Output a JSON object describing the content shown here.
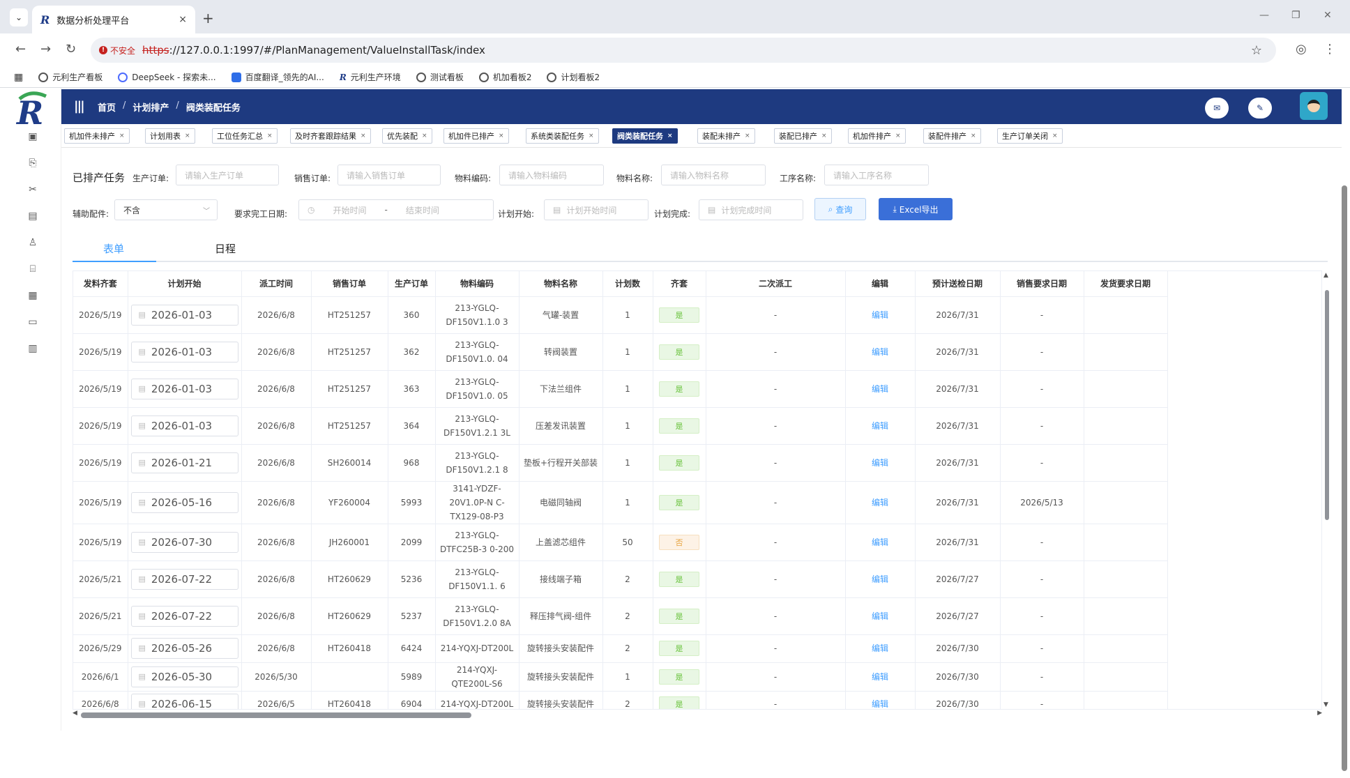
{
  "browser": {
    "tab_title": "数据分析处理平台",
    "tab_close": "×",
    "new_tab": "+",
    "insecure_label": "不安全",
    "url_proto": "https",
    "url_rest": "://127.0.0.1:1997/#/PlanManagement/ValueInstallTask/index",
    "bookmarks": [
      "元利生产看板",
      "DeepSeek - 探索未...",
      "百度翻译_领先的AI...",
      "元利生产环境",
      "测试看板",
      "机加看板2",
      "计划看板2"
    ]
  },
  "header": {
    "breadcrumb": [
      "首页",
      "计划排产",
      "阀类装配任务"
    ],
    "sep": "/"
  },
  "tags": [
    {
      "label": "机加件未排产",
      "active": false
    },
    {
      "label": "计划用表",
      "active": false
    },
    {
      "label": "工位任务汇总",
      "active": false
    },
    {
      "label": "及时齐套跟踪结果",
      "active": false
    },
    {
      "label": "优先装配",
      "active": false
    },
    {
      "label": "机加件已排产",
      "active": false
    },
    {
      "label": "系统类装配任务",
      "active": false
    },
    {
      "label": "阀类装配任务",
      "active": true
    },
    {
      "label": "装配未排产",
      "active": false
    },
    {
      "label": "装配已排产",
      "active": false
    },
    {
      "label": "机加件排产",
      "active": false
    },
    {
      "label": "装配件排产",
      "active": false
    },
    {
      "label": "生产订单关闭",
      "active": false
    }
  ],
  "filters": {
    "title": "已排产任务",
    "prod_order_label": "生产订单:",
    "prod_order_placeholder": "请输入生产订单",
    "sales_order_label": "销售订单:",
    "sales_order_placeholder": "请输入销售订单",
    "material_code_label": "物料编码:",
    "material_code_placeholder": "请输入物料编码",
    "material_name_label": "物料名称:",
    "material_name_placeholder": "请输入物料名称",
    "process_label": "工序名称:",
    "process_placeholder": "请输入工序名称",
    "aux_label": "辅助配件:",
    "aux_value": "不含",
    "due_label": "要求完工日期:",
    "start_placeholder": "开始时间",
    "range_sep": "-",
    "end_placeholder": "结束时间",
    "plan_start_label": "计划开始:",
    "plan_start_placeholder": "计划开始时间",
    "plan_end_label": "计划完成:",
    "plan_end_placeholder": "计划完成时间",
    "query_btn": "查询",
    "excel_btn": "Excel导出"
  },
  "view_tabs": [
    "表单",
    "日程"
  ],
  "table": {
    "columns": [
      "发料齐套",
      "计划开始",
      "派工时间",
      "销售订单",
      "生产订单",
      "物料编码",
      "物料名称",
      "计划数",
      "齐套",
      "二次派工",
      "编辑",
      "预计送检日期",
      "销售要求日期",
      "发货要求日期"
    ],
    "rows": [
      [
        "2026/5/19",
        "2026-01-03",
        "2026/6/8",
        "HT251257",
        "360",
        "213-YGLQ-DF150V1.1.0 3",
        "气罐-装置",
        "1",
        "是",
        "-",
        "编辑",
        "2026/7/31",
        "-",
        ""
      ],
      [
        "2026/5/19",
        "2026-01-03",
        "2026/6/8",
        "HT251257",
        "362",
        "213-YGLQ-DF150V1.0. 04",
        "转阀装置",
        "1",
        "是",
        "-",
        "编辑",
        "2026/7/31",
        "-",
        ""
      ],
      [
        "2026/5/19",
        "2026-01-03",
        "2026/6/8",
        "HT251257",
        "363",
        "213-YGLQ-DF150V1.0. 05",
        "下法兰组件",
        "1",
        "是",
        "-",
        "编辑",
        "2026/7/31",
        "-",
        ""
      ],
      [
        "2026/5/19",
        "2026-01-03",
        "2026/6/8",
        "HT251257",
        "364",
        "213-YGLQ-DF150V1.2.1 3L",
        "压差发讯装置",
        "1",
        "是",
        "-",
        "编辑",
        "2026/7/31",
        "-",
        ""
      ],
      [
        "2026/5/19",
        "2026-01-21",
        "2026/6/8",
        "SH260014",
        "968",
        "213-YGLQ-DF150V1.2.1 8",
        "垫板+行程开关部装",
        "1",
        "是",
        "-",
        "编辑",
        "2026/7/31",
        "-",
        ""
      ],
      [
        "2026/5/19",
        "2026-05-16",
        "2026/6/8",
        "YF260004",
        "5993",
        "3141-YDZF-20V1.0P-N C-TX129-08-P3",
        "电磁同轴阀",
        "1",
        "是",
        "-",
        "编辑",
        "2026/7/31",
        "2026/5/13",
        ""
      ],
      [
        "2026/5/19",
        "2026-07-30",
        "2026/6/8",
        "JH260001",
        "2099",
        "213-YGLQ-DTFC25B-3 0-200",
        "上盖滤芯组件",
        "50",
        "否",
        "-",
        "编辑",
        "2026/7/31",
        "-",
        ""
      ],
      [
        "2026/5/21",
        "2026-07-22",
        "2026/6/8",
        "HT260629",
        "5236",
        "213-YGLQ-DF150V1.1. 6",
        "接线端子箱",
        "2",
        "是",
        "-",
        "编辑",
        "2026/7/27",
        "-",
        ""
      ],
      [
        "2026/5/21",
        "2026-07-22",
        "2026/6/8",
        "HT260629",
        "5237",
        "213-YGLQ-DF150V1.2.0 8A",
        "释压排气阀-组件",
        "2",
        "是",
        "-",
        "编辑",
        "2026/7/27",
        "-",
        ""
      ],
      [
        "2026/5/29",
        "2026-05-26",
        "2026/6/8",
        "HT260418",
        "6424",
        "214-YQXJ-DT200L",
        "旋转接头安装配件",
        "2",
        "是",
        "-",
        "编辑",
        "2026/7/30",
        "-",
        ""
      ],
      [
        "2026/6/1",
        "2026-05-30",
        "2026/5/30",
        "",
        "5989",
        "214-YQXJ-QTE200L-S6",
        "旋转接头安装配件",
        "1",
        "是",
        "-",
        "编辑",
        "2026/7/30",
        "-",
        ""
      ],
      [
        "2026/6/8",
        "2026-06-15",
        "2026/6/5",
        "HT260418",
        "6904",
        "214-YQXJ-DT200L",
        "旋转接头安装配件",
        "2",
        "是",
        "-",
        "编辑",
        "2026/7/30",
        "-",
        ""
      ]
    ]
  }
}
